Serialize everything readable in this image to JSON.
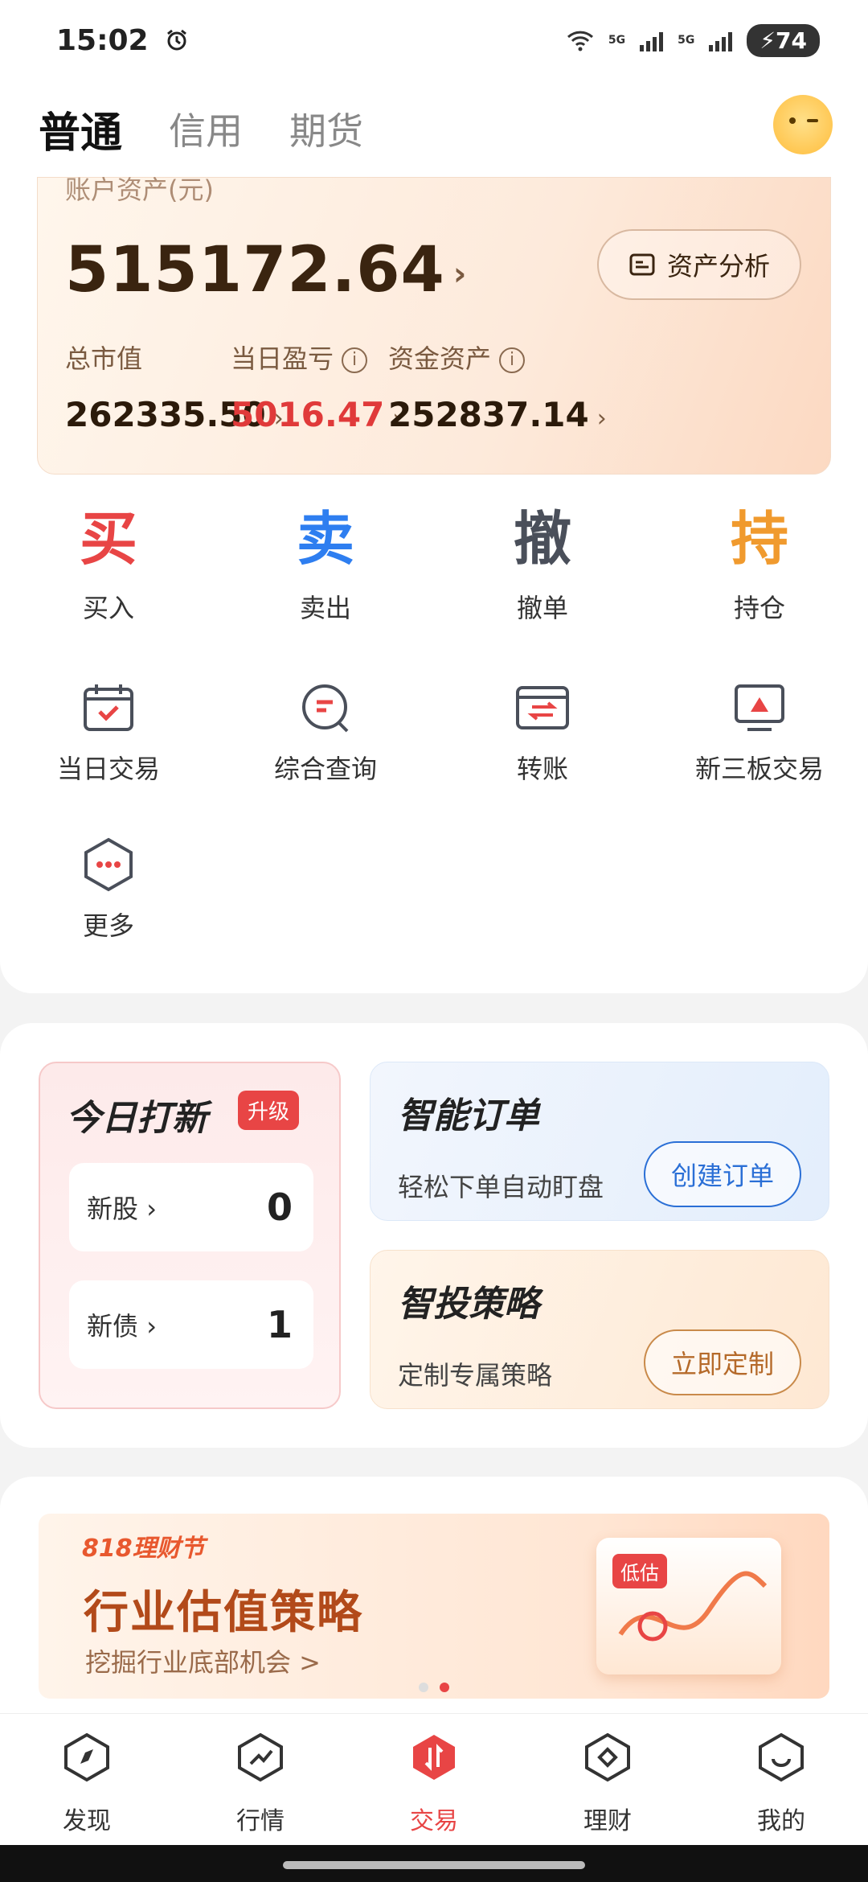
{
  "status_bar": {
    "time": "15:02",
    "battery": "74",
    "net1": "5G",
    "net2": "5G"
  },
  "tabs": [
    {
      "label": "普通",
      "active": true
    },
    {
      "label": "信用",
      "active": false
    },
    {
      "label": "期货",
      "active": false
    }
  ],
  "account": {
    "title": "账户资产(元)",
    "total": "515172.64",
    "analysis_button": "资产分析",
    "metrics": [
      {
        "label": "总市值",
        "value": "262335.50"
      },
      {
        "label": "当日盈亏",
        "value": "5016.47"
      },
      {
        "label": "资金资产",
        "value": "252837.14"
      }
    ]
  },
  "actions": [
    {
      "glyph": "买",
      "label": "买入",
      "color": "#e84545"
    },
    {
      "glyph": "卖",
      "label": "卖出",
      "color": "#2e7ef0"
    },
    {
      "glyph": "撤",
      "label": "撤单",
      "color": "#4a4f5a"
    },
    {
      "glyph": "持",
      "label": "持仓",
      "color": "#f09a2e"
    }
  ],
  "tools": [
    {
      "label": "当日交易",
      "icon": "calendar-check-icon"
    },
    {
      "label": "综合查询",
      "icon": "search-query-icon"
    },
    {
      "label": "转账",
      "icon": "transfer-icon"
    },
    {
      "label": "新三板交易",
      "icon": "neeq-icon"
    },
    {
      "label": "更多",
      "icon": "more-hex-icon"
    }
  ],
  "ipo": {
    "title": "今日打新",
    "badge": "升级",
    "rows": [
      {
        "label": "新股",
        "value": "0"
      },
      {
        "label": "新债",
        "value": "1"
      }
    ]
  },
  "smart_order": {
    "title": "智能订单",
    "subtitle": "轻松下单自动盯盘",
    "button": "创建订单"
  },
  "strategy": {
    "title": "智投策略",
    "subtitle": "定制专属策略",
    "button": "立即定制"
  },
  "banner": {
    "tag": "818理财节",
    "headline": "行业估值策略",
    "sub": "挖掘行业底部机会 >",
    "chart_label": "低估"
  },
  "nav": [
    {
      "label": "发现",
      "active": false
    },
    {
      "label": "行情",
      "active": false
    },
    {
      "label": "交易",
      "active": true
    },
    {
      "label": "理财",
      "active": false
    },
    {
      "label": "我的",
      "active": false
    }
  ]
}
